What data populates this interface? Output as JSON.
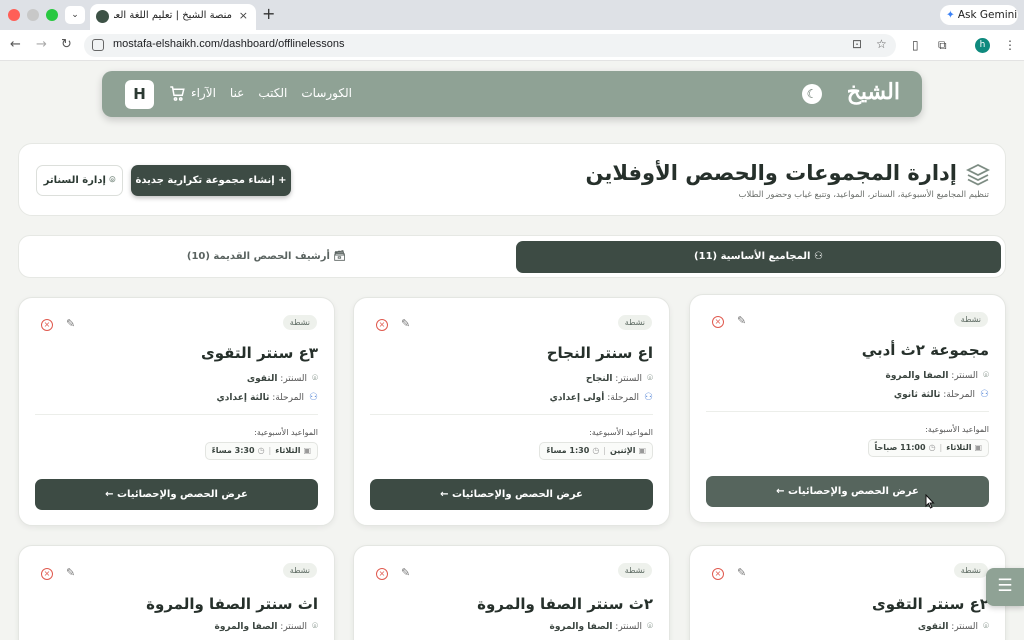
{
  "browser": {
    "tab_title": "منصة الشيخ | تعليم اللغة العربية ل",
    "tab_close": "×",
    "new_tab": "+",
    "dropdown": "⌄",
    "gemini_label": "Ask Gemini",
    "url": "mostafa-elshaikh.com/dashboard/offlinelessons",
    "profile_initial": "h"
  },
  "site": {
    "logo": "الشيخ",
    "nav": [
      "الكورسات",
      "الكتب",
      "عنا",
      "الآراء"
    ],
    "user_initial": "H"
  },
  "page": {
    "title": "إدارة المجموعات والحصص الأوفلاين",
    "subtitle": "تنظيم المجاميع الأسبوعية، السناتر، المواعيد، وتتبع غياب وحضور الطلاب",
    "create_button": "إنشاء مجموعة تكرارية جديدة",
    "centers_button": "إدارة السناتر"
  },
  "tabs": {
    "active": "المجاميع الأساسية (11)",
    "archive": "أرشيف الحصص القديمة (10)"
  },
  "labels": {
    "center_prefix": "السنتر:",
    "stage_prefix": "المرحلة:",
    "schedule": "المواعيد الأسبوعية:",
    "view_button": "عرض الحصص والإحصائيات"
  },
  "groups": [
    {
      "status": "نشطة",
      "name": "مجموعة ٢ث أدبي",
      "center": "الصفا والمروة",
      "stage": "ثالثة ثانوي",
      "day": "الثلاثاء",
      "time": "11:00 صباحاً"
    },
    {
      "status": "نشطة",
      "name": "اع سنتر النجاح",
      "center": "النجاح",
      "stage": "أولى إعدادي",
      "day": "الإثنين",
      "time": "1:30 مساءً"
    },
    {
      "status": "نشطة",
      "name": "٣ع سنتر التقوى",
      "center": "التقوى",
      "stage": "ثالثة إعدادي",
      "day": "الثلاثاء",
      "time": "3:30 مساءً"
    },
    {
      "status": "نشطة",
      "name": "٢ع سنتر التقوى",
      "center": "التقوى"
    },
    {
      "status": "نشطة",
      "name": "٢ث سنتر الصفا والمروة",
      "center": "الصفا والمروة"
    },
    {
      "status": "نشطة",
      "name": "اث سنتر الصفا والمروة",
      "center": "الصفا والمروة"
    }
  ],
  "colors": {
    "primary": "#3d4b44",
    "header": "#8fa295",
    "danger": "#e05a4f"
  }
}
